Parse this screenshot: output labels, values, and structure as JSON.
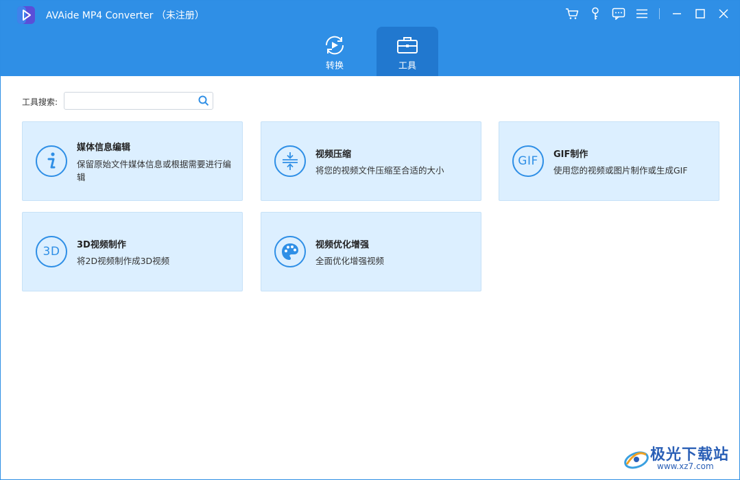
{
  "window": {
    "title": "AVAide MP4 Converter  （未注册）",
    "accent": "#2f8fe6"
  },
  "titlebar_icons": [
    "cart-icon",
    "key-icon",
    "chat-icon",
    "menu-icon",
    "minimize-icon",
    "maximize-icon",
    "close-icon"
  ],
  "tabs": [
    {
      "label": "转换",
      "icon": "convert-icon",
      "active": false
    },
    {
      "label": "工具",
      "icon": "toolbox-icon",
      "active": true
    }
  ],
  "search": {
    "label": "工具搜索:",
    "value": "",
    "placeholder": ""
  },
  "tools": [
    {
      "title": "媒体信息编辑",
      "desc": "保留原始文件媒体信息或根据需要进行编辑",
      "icon": "info-icon"
    },
    {
      "title": "视频压缩",
      "desc": "将您的视频文件压缩至合适的大小",
      "icon": "compress-icon"
    },
    {
      "title": "GIF制作",
      "desc": "使用您的视频或图片制作或生成GIF",
      "icon": "gif-icon",
      "icon_text": "GIF"
    },
    {
      "title": "3D视频制作",
      "desc": "将2D视频制作成3D视频",
      "icon": "3d-icon",
      "icon_text": "3D"
    },
    {
      "title": "视频优化增强",
      "desc": "全面优化增强视频",
      "icon": "palette-icon"
    }
  ],
  "watermark": {
    "name": "极光下载站",
    "url": "www.xz7.com"
  }
}
